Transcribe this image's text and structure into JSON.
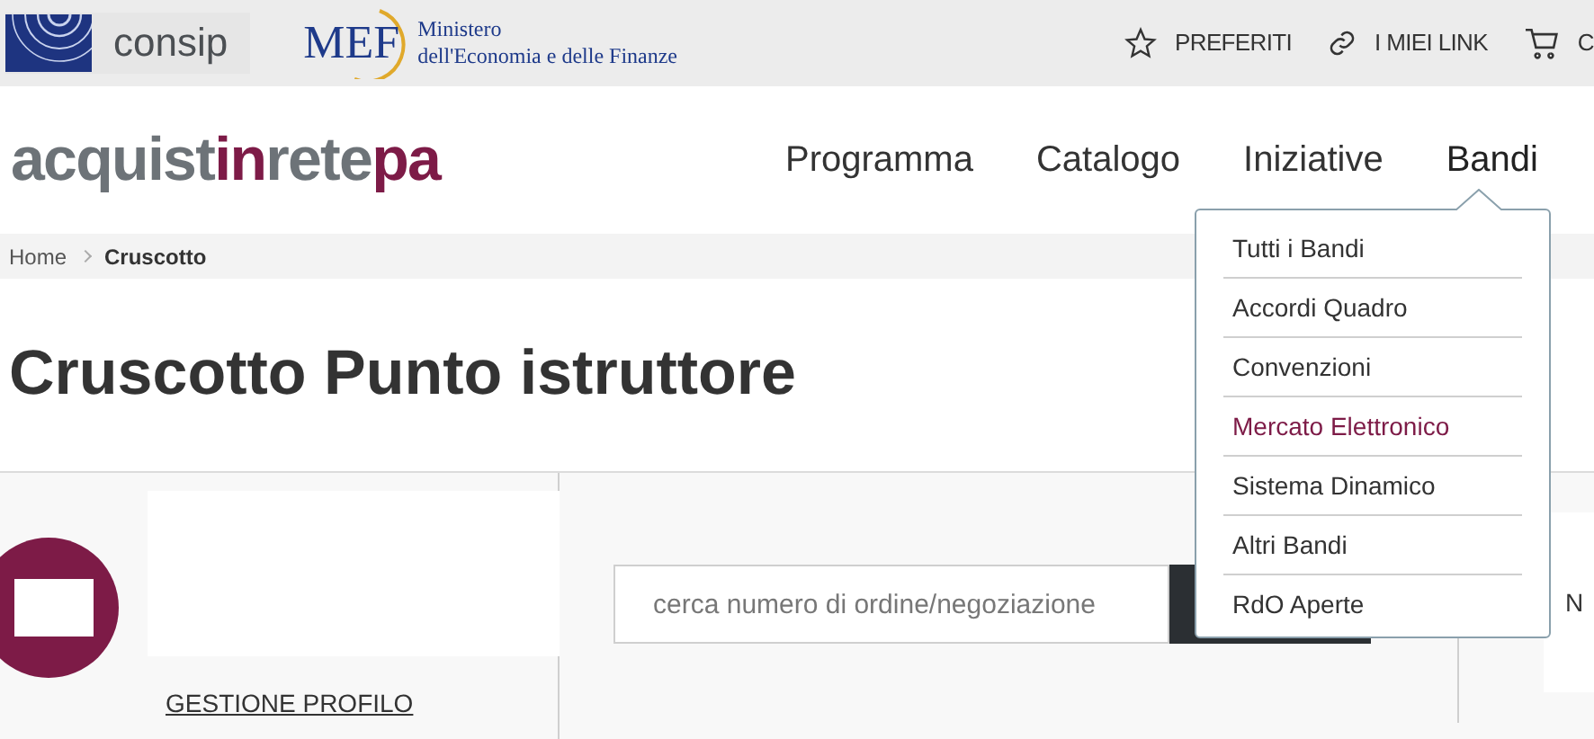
{
  "top_bar": {
    "consip": "consip",
    "mef": {
      "mark": "MEF",
      "line_1": "Ministero",
      "line_2": "dell'Economia e delle Finanze"
    },
    "links": [
      {
        "kind": "star",
        "label": "PREFERITI"
      },
      {
        "kind": "link",
        "label": "I MIEI LINK"
      },
      {
        "kind": "cart",
        "label": "C"
      }
    ]
  },
  "logo": [
    {
      "text": "acquist",
      "color": "#6d7378"
    },
    {
      "text": "in",
      "color": "#7d1b47"
    },
    {
      "text": "rete",
      "color": "#6d7378"
    },
    {
      "text": "pa",
      "color": "#7d1b47"
    }
  ],
  "nav": [
    {
      "label": "Programma",
      "expanded": false
    },
    {
      "label": "Catalogo",
      "expanded": false
    },
    {
      "label": "Iniziative",
      "expanded": false
    },
    {
      "label": "Bandi",
      "expanded": true
    }
  ],
  "dropdown": [
    {
      "label": "Tutti i Bandi",
      "selected": false
    },
    {
      "label": "Accordi Quadro",
      "selected": false
    },
    {
      "label": "Convenzioni",
      "selected": false
    },
    {
      "label": "Mercato Elettronico",
      "selected": true
    },
    {
      "label": "Sistema Dinamico",
      "selected": false
    },
    {
      "label": "Altri Bandi",
      "selected": false
    },
    {
      "label": "RdO Aperte",
      "selected": false
    }
  ],
  "breadcrumb": [
    {
      "label": "Home"
    },
    {
      "label": "Cruscotto"
    }
  ],
  "title": "Cruscotto Punto istruttore",
  "profile": {
    "link": "GESTIONE PROFILO"
  },
  "search": {
    "placeholder": "cerca numero di ordine/negoziazione"
  },
  "right_card": {
    "text": "N"
  }
}
